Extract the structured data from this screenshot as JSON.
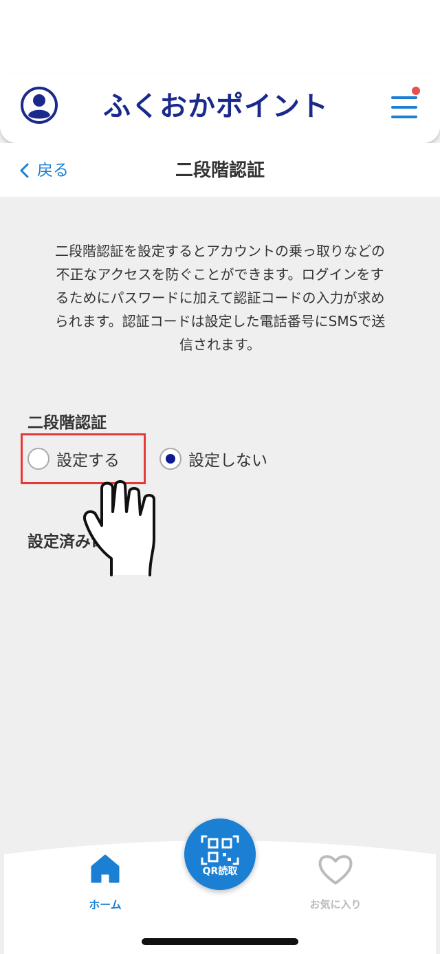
{
  "header": {
    "logo_text": "ふくおかポイント",
    "icons": {
      "avatar": "user-avatar-icon",
      "menu": "hamburger-menu-icon"
    },
    "colors": {
      "brand": "#1a2a8c",
      "accent": "#1b7fd3",
      "notification": "#e8504a"
    }
  },
  "nav": {
    "back_label": "戻る",
    "title": "二段階認証"
  },
  "content": {
    "description_lines": [
      "二段階認証を設定するとアカウントの乗っ取りなどの",
      "不正なアクセスを防ぐことができます。ログインをす",
      "るためにパスワードに加えて認証コードの入力が求め",
      "られます。認証コードは設定した電話番号にSMSで送",
      "信されます。"
    ],
    "section_label": "二段階認証",
    "options": [
      {
        "label": "設定する",
        "checked": false
      },
      {
        "label": "設定しない",
        "checked": true
      }
    ],
    "phone_section_label": "設定済み電話番号"
  },
  "tabbar": {
    "home_label": "ホーム",
    "qr_label": "QR読取",
    "fav_label": "お気に入り",
    "colors": {
      "active": "#1b7fd3",
      "inactive": "#bbbbbb"
    }
  }
}
